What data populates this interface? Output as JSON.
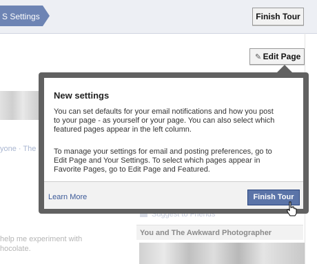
{
  "topbar": {
    "crumb_label": "S Settings",
    "finish_tour_label": "Finish Tour"
  },
  "page": {
    "edit_page_label": "Edit Page",
    "edit_page_icon": "pencil-icon",
    "faded_link": "yone · The",
    "faded_text_1": "help me experiment with",
    "faded_text_2": "hocolate.",
    "suggest_label": "Suggest to Friends",
    "section_header": "You and The Awkward Photographer"
  },
  "dialog": {
    "title": "New settings",
    "para1": "You can set defaults for your email notifications and how you post to your page - as yourself or your page. You can also select which featured pages appear in the left column.",
    "para2": "To manage your settings for email and posting preferences, go to Edit Page and Your Settings. To select which pages appear in Favorite Pages, go to Edit Page and Featured.",
    "learn_more": "Learn More",
    "finish_tour_label": "Finish Tour"
  },
  "colors": {
    "accent": "#5b74a8",
    "link": "#3b5998",
    "dialog_border": "#616161"
  }
}
